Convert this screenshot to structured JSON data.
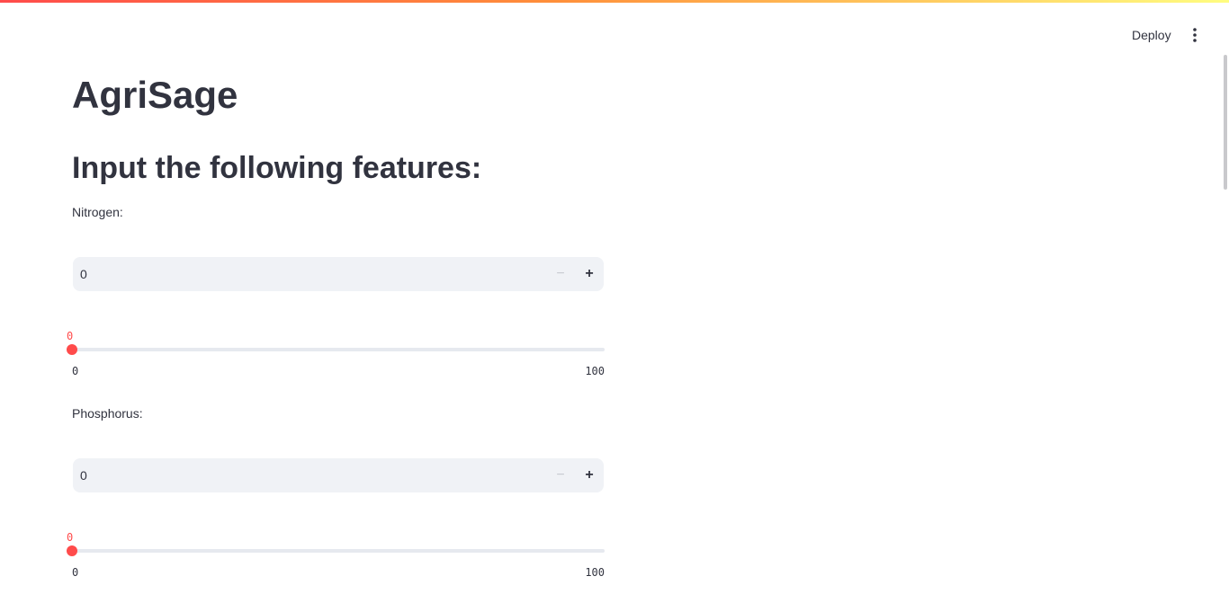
{
  "header": {
    "deploy_label": "Deploy",
    "menu_icon": "vertical-ellipsis-icon"
  },
  "app": {
    "title": "AgriSage",
    "section_title": "Input the following features:"
  },
  "features": [
    {
      "label": "Nitrogen:",
      "input_value": "0",
      "minus": "−",
      "plus": "+",
      "slider": {
        "current": "0",
        "min": "0",
        "max": "100",
        "value_fraction": 0
      }
    },
    {
      "label": "Phosphorus:",
      "input_value": "0",
      "minus": "−",
      "plus": "+",
      "slider": {
        "current": "0",
        "min": "0",
        "max": "100",
        "value_fraction": 0
      }
    }
  ],
  "colors": {
    "accent": "#ff4b4b",
    "input_background": "#f0f2f6",
    "text": "#31333f"
  }
}
